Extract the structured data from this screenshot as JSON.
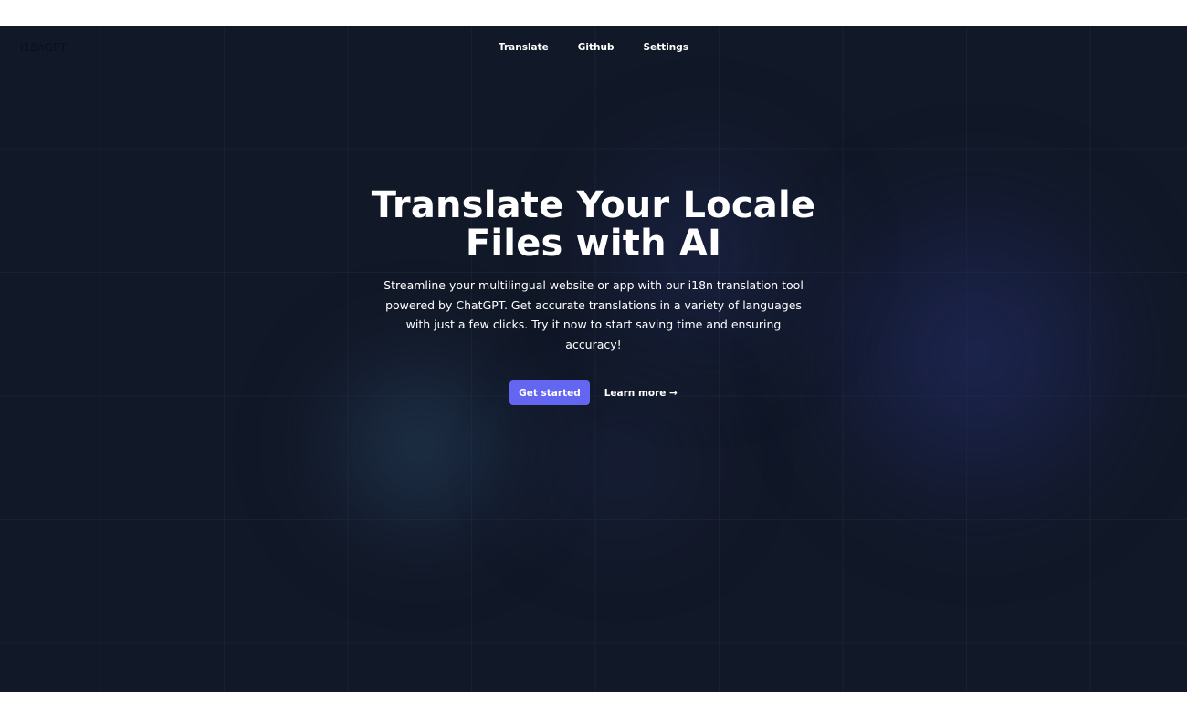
{
  "logo": {
    "text": "i18nGPT"
  },
  "nav": {
    "items": [
      {
        "label": "Translate"
      },
      {
        "label": "Github"
      },
      {
        "label": "Settings"
      }
    ]
  },
  "hero": {
    "title": "Translate Your Locale Files with AI",
    "description": "Streamline your multilingual website or app with our i18n translation tool powered by ChatGPT. Get accurate translations in a variety of languages with just a few clicks. Try it now to start saving time and ensuring accuracy!",
    "primary_cta": "Get started",
    "secondary_cta": "Learn more →"
  },
  "colors": {
    "background": "#111827",
    "accent": "#6366f1",
    "text": "#ffffff"
  }
}
